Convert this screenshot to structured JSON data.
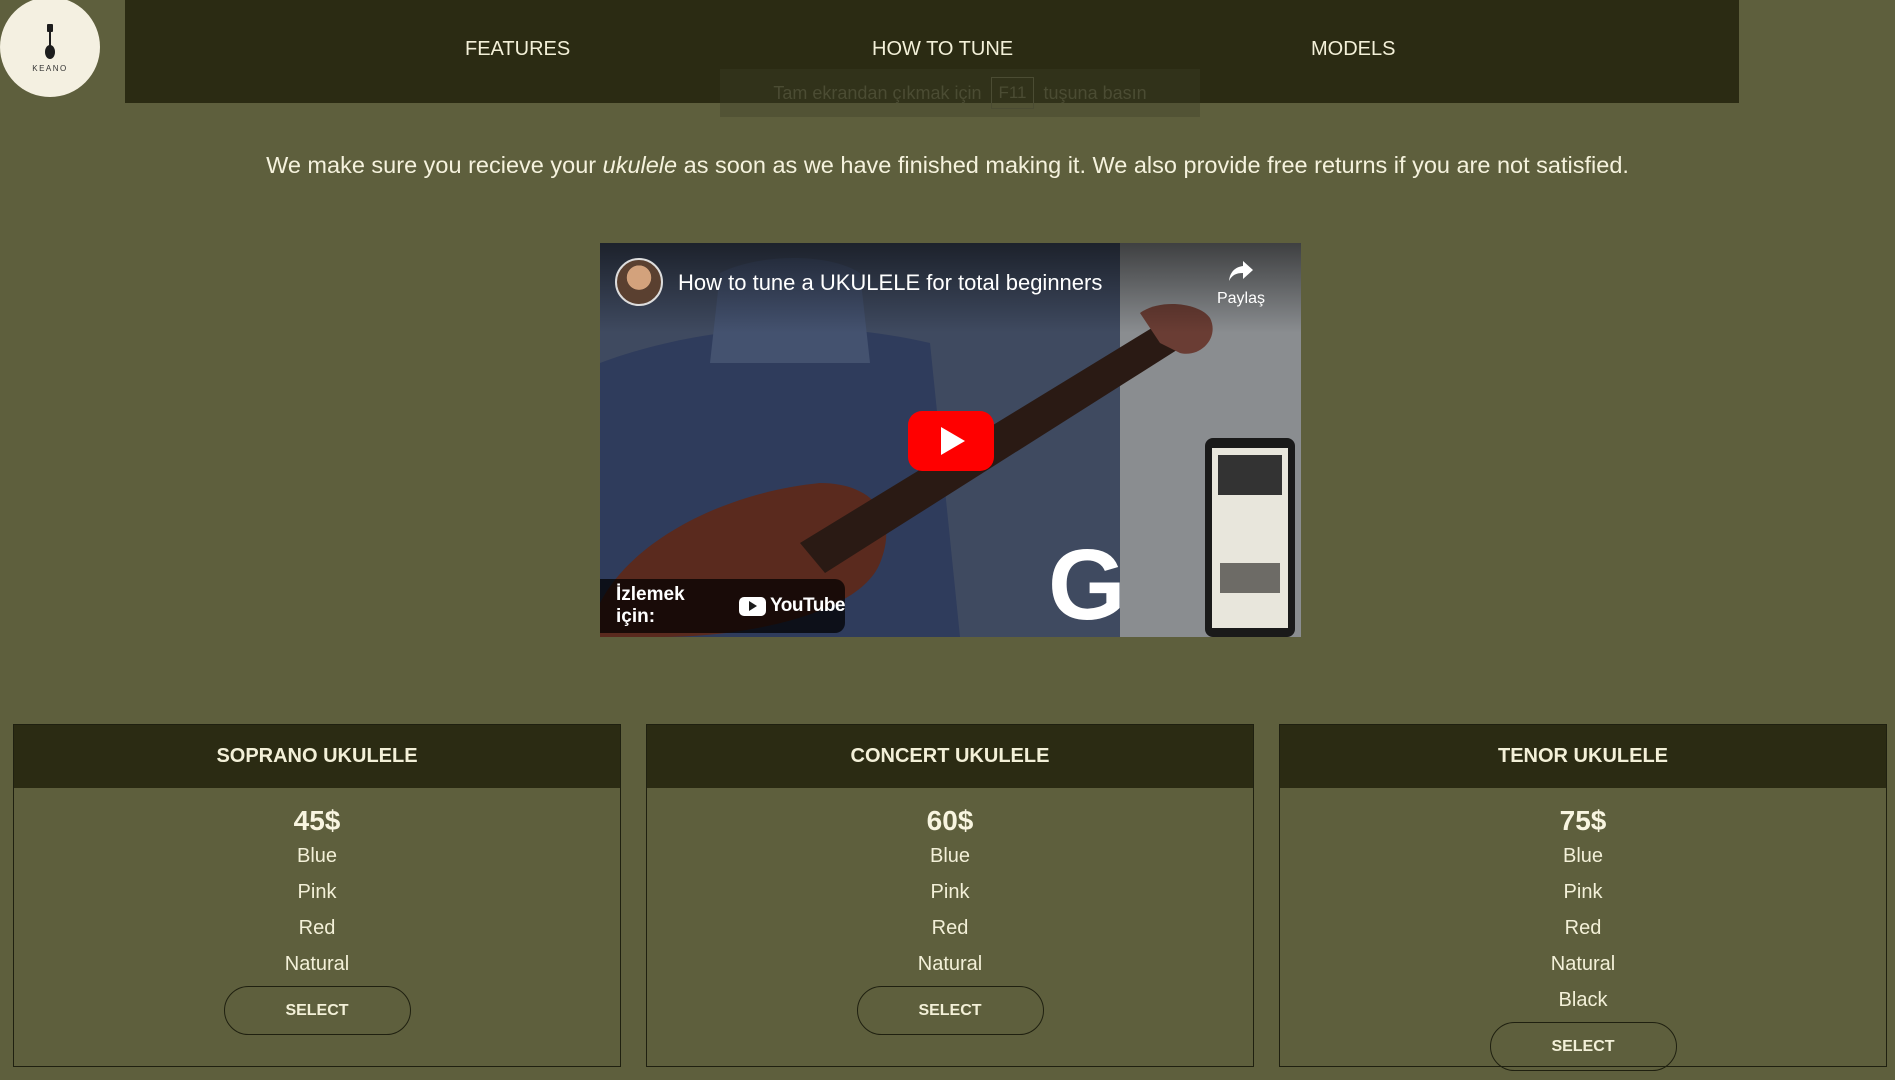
{
  "logo": {
    "text": "KEANO"
  },
  "nav": {
    "items": [
      {
        "label": "FEATURES"
      },
      {
        "label": "HOW TO TUNE"
      },
      {
        "label": "MODELS"
      }
    ]
  },
  "fullscreen_hint": {
    "before": "Tam ekrandan çıkmak için",
    "key": "F11",
    "after": "tuşuna basın"
  },
  "intro": {
    "text_before": "We make sure you recieve your ",
    "emphasis": "ukulele",
    "text_after": " as soon as we have finished making it. We also provide free returns if you are not satisfied."
  },
  "video": {
    "title": "How to tune a UKULELE for total beginners",
    "share_label": "Paylaş",
    "watch_on_label": "İzlemek için:",
    "youtube_label": "YouTube",
    "overlay_letter": "G"
  },
  "products": [
    {
      "name": "SOPRANO UKULELE",
      "price": "45$",
      "options": [
        "Blue",
        "Pink",
        "Red",
        "Natural"
      ],
      "button": "SELECT"
    },
    {
      "name": "CONCERT UKULELE",
      "price": "60$",
      "options": [
        "Blue",
        "Pink",
        "Red",
        "Natural"
      ],
      "button": "SELECT"
    },
    {
      "name": "TENOR UKULELE",
      "price": "75$",
      "options": [
        "Blue",
        "Pink",
        "Red",
        "Natural",
        "Black"
      ],
      "button": "SELECT"
    }
  ],
  "colors": {
    "page_background": "#5e5f3d",
    "nav_background": "#2b2b13",
    "text": "#f3f0d8",
    "play_button": "#ff0000"
  }
}
